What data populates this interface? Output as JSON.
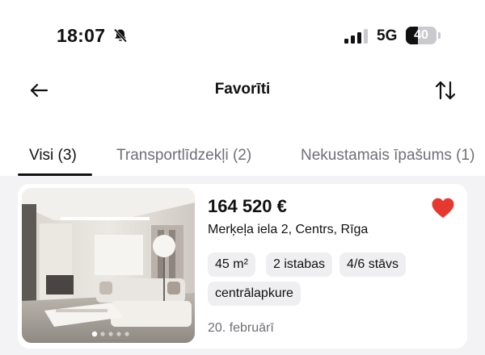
{
  "status_bar": {
    "time": "18:07",
    "network": "5G",
    "battery": "40",
    "battery_level_percent": 40
  },
  "header": {
    "title": "Favorīti"
  },
  "tabs": [
    {
      "label": "Visi (3)",
      "active": true
    },
    {
      "label": "Transportlīdzekļi (2)",
      "active": false
    },
    {
      "label": "Nekustamais īpašums (1)",
      "active": false
    }
  ],
  "listing": {
    "price": "164 520 €",
    "address": "Merķeļa iela 2, Centrs, Rīga",
    "chips": [
      "45 m²",
      "2 istabas",
      "4/6 stāvs",
      "centrālapkure"
    ],
    "date": "20. februārī",
    "favorite": true,
    "photo_count": 5,
    "photo_index": 1
  },
  "colors": {
    "heart": "#e5382f",
    "active_tab": "#111111",
    "inactive_tab": "#6f6f76",
    "chip_bg": "#efeff2"
  },
  "icons": {
    "mute": "bell-slash-icon",
    "back": "arrow-left-icon",
    "sort": "sort-arrows-icon",
    "favorite": "heart-icon"
  }
}
